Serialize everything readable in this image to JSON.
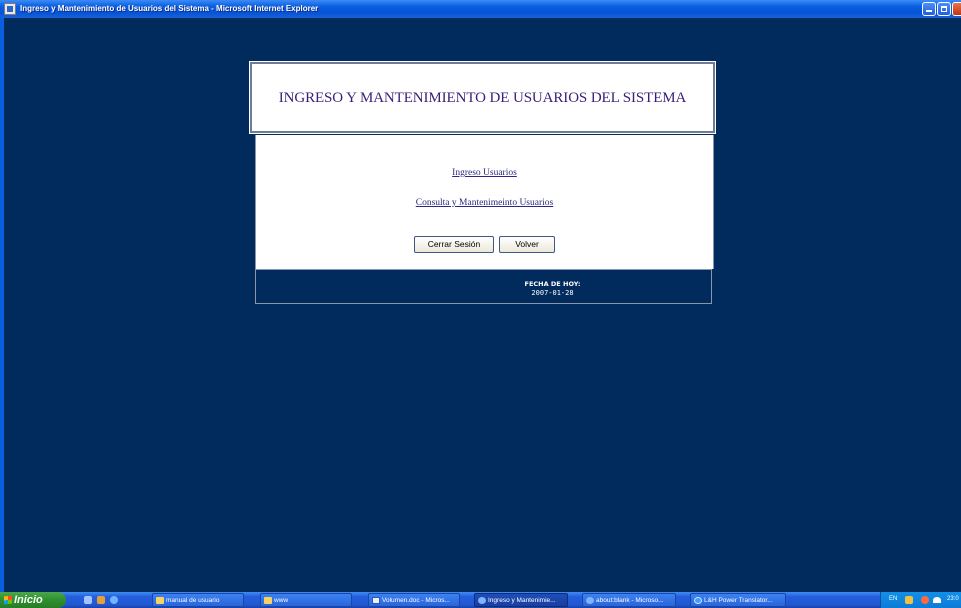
{
  "window": {
    "title": "Ingreso y Mantenimiento de Usuarios del Sistema - Microsoft Internet Explorer"
  },
  "page": {
    "heading": "INGRESO Y MANTENIMIENTO DE USUARIOS DEL SISTEMA",
    "links": {
      "ingreso": "Ingreso Usuarios",
      "consulta": "Consulta y Mantenimeinto Usuarios"
    },
    "buttons": {
      "cerrar": "Cerrar Sesión",
      "volver": "Volver"
    },
    "footer": {
      "fecha_label": "FECHA DE HOY:",
      "fecha_value": "2007-01-28"
    }
  },
  "taskbar": {
    "start_label": "Inicio",
    "tasks": [
      "manual de usuario",
      "www",
      "Volumen.doc - Micros...",
      "Ingreso y Mantenimie...",
      "about:blank - Microso...",
      "L&H Power Translator..."
    ],
    "tray": {
      "language": "EN",
      "clock": "23:0"
    }
  },
  "colors": {
    "page_background": "#002b5c",
    "heading_color": "#3a1f78",
    "link_color": "#2c2780"
  }
}
